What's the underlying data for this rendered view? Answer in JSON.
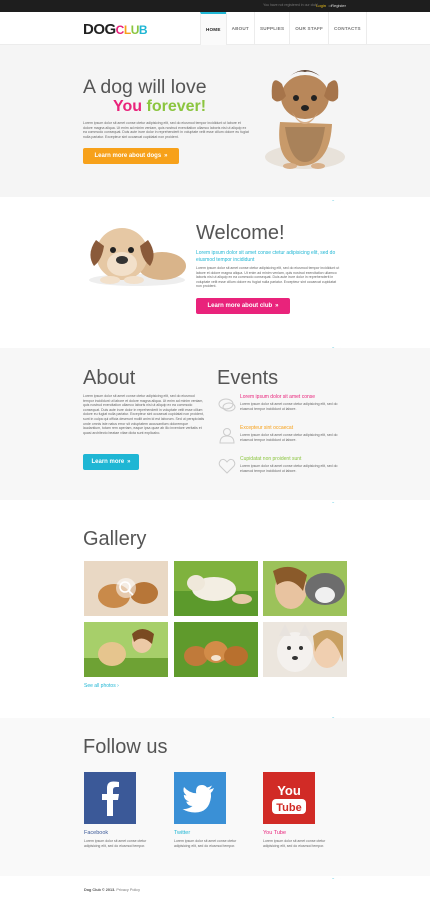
{
  "topbar": {
    "note": "You have not registered in our club!",
    "login": "Login",
    "sep": "or",
    "register": "Register"
  },
  "logo": {
    "part1": "DOG",
    "part2": [
      "C",
      "L",
      "U",
      "B"
    ]
  },
  "nav": [
    "HOME",
    "ABOUT",
    "SUPPLIES",
    "OUR STAFF",
    "CONTACTS"
  ],
  "hero": {
    "title": "A dog will love",
    "you": "You",
    "forever": "forever!",
    "text": "Lorem ipsum dolor sit amet conse ctetur adipisicing elit, sed do eiusmod tempor incididunt ut labore et dolore magna aliqua. Ut enim ad minim veniam, quis nostrud exercitation ullamco laboris nisi ut aliquip ex ea commodo consequat. Duis aute irure dolor in reprehenderit in voluptate velit esse cillum dolore eu fugiat nulla pariatur. Excepteur sint occaecat cupidatat non proident.",
    "button": "Learn more about dogs"
  },
  "top_link": "Top",
  "welcome": {
    "title": "Welcome!",
    "teal": "Lorem ipsum dolor sit amet conse ctetur adipisicing elit, sed do eiusmod tempor incididunt",
    "text": "Lorem ipsum dolor sit amet conse ctetur adipisicing elit, sed do eiusmod tempor incididunt ut labore et dolore magna aliqua. Ut enim ad minim veniam, quis nostrud exercitation ullamco laboris nisi ut aliquip ex ea commodo consequat. Duis aute irure dolor in reprehenderit in voluptate velit esse cillum dolore eu fugiat nulla pariatur. Excepteur sint occaecat cupidatat non proident.",
    "button": "Learn more about club"
  },
  "about": {
    "title": "About",
    "text": "Lorem ipsum dolor sit amet conse ctetur adipisicing elit, sed do eiusmod tempor incididunt ut labore et dolore magna aliqua. Ut enim ad minim veniam, quis nostrud exercitation ullamco laboris nisi ut aliquip ex ea commodo consequat. Duis aute irure dolor in reprehenderit in voluptate velit esse cillum dolore eu fugiat nulla pariatur. Excepteur sint occaecat cupidatat non proident, sunt in culpa qui officia deserunt mollit anim id est laborum. Sed ut perspiciatis unde omnis iste natus error sit voluptatem accusantium doloremque laudantium, totam rem aperiam, eaque ipsa quae ab illo inventore veritatis et quasi architecto beatae vitae dicta sunt explicabo.",
    "button": "Learn more"
  },
  "events": {
    "title": "Events",
    "items": [
      {
        "title": "Lorem ipsum dolor sit amet conse",
        "color": "#e9237b",
        "text": "Lorem ipsum dolor sit amet conse ctetur adipisicing elit, sed do eiusmod tempor incididunt ut labore.",
        "icon": "chat-icon"
      },
      {
        "title": "Excepteur sint occaecat",
        "color": "#f7a11a",
        "text": "Lorem ipsum dolor sit amet conse ctetur adipisicing elit, sed do eiusmod tempor incididunt ut labore.",
        "icon": "user-icon"
      },
      {
        "title": "Cupidatat non proident sunt",
        "color": "#8bc53f",
        "text": "Lorem ipsum dolor sit amet conse ctetur adipisicing elit, sed do eiusmod tempor incididunt ut labore.",
        "icon": "heart-icon"
      }
    ]
  },
  "gallery": {
    "title": "Gallery",
    "see_all": "See all photos"
  },
  "follow": {
    "title": "Follow us",
    "items": [
      {
        "label": "Facebook",
        "color": "#3b5998",
        "text": "Lorem ipsum dolor sit amet conse ctetur adipisicing elit, sed do eiusmod tempor."
      },
      {
        "label": "Twitter",
        "color": "#1fb6d4",
        "text": "Lorem ipsum dolor sit amet conse ctetur adipisicing elit, sed do eiusmod tempor."
      },
      {
        "label": "You Tube",
        "color": "#e9237b",
        "text": "Lorem ipsum dolor sit amet conse ctetur adipisicing elit, sed do eiusmod tempor."
      }
    ]
  },
  "footer": {
    "copyright": "Dog Club © 2013.",
    "privacy": "Privacy Policy"
  }
}
